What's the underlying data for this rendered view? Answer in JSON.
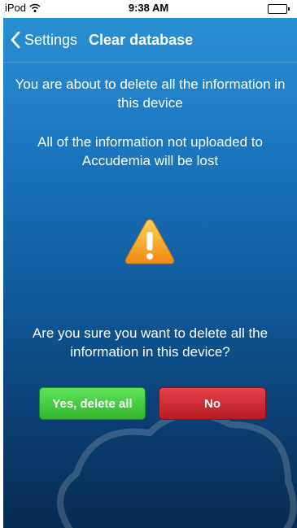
{
  "status_bar": {
    "carrier": "iPod",
    "time": "9:38 AM"
  },
  "nav": {
    "back_label": "Settings",
    "title": "Clear database"
  },
  "messages": {
    "warning_line1": "You are about to delete all the information in this device",
    "warning_line2": "All of the information not uploaded to Accudemia will be lost",
    "confirm_question": "Are you sure you want to delete all the information in this device?"
  },
  "buttons": {
    "yes_label": "Yes, delete all",
    "no_label": "No"
  },
  "colors": {
    "background_top": "#2a8fd3",
    "background_bottom": "#072c54",
    "yes_button": "#3fc73a",
    "no_button": "#cf2a33",
    "warning_icon": "#f59d1f"
  },
  "icons": {
    "back": "chevron-left-icon",
    "warning": "warning-triangle-icon",
    "wifi": "wifi-icon",
    "battery": "battery-icon"
  }
}
